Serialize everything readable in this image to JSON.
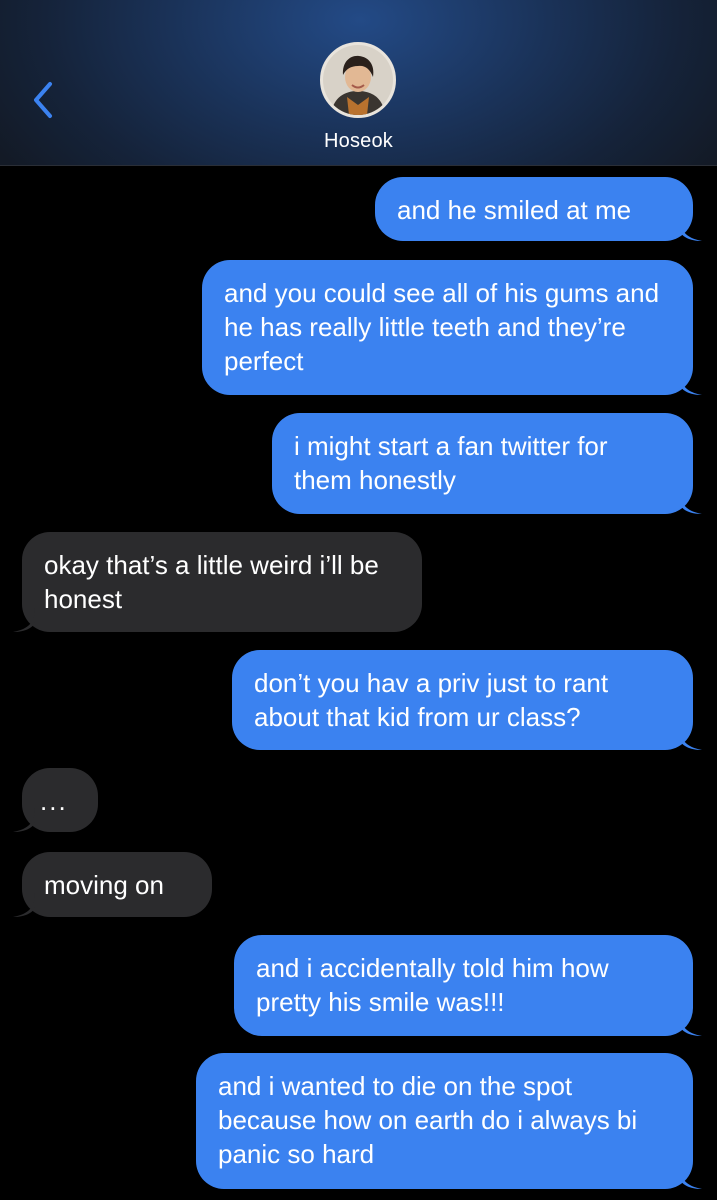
{
  "header": {
    "contact_name": "Hoseok",
    "back_icon": "chevron-left-icon",
    "avatar_icon": "contact-avatar"
  },
  "colors": {
    "sent_bubble": "#3b82f0",
    "received_bubble": "#2b2b2d",
    "accent": "#3b82f0",
    "background": "#000000"
  },
  "messages": [
    {
      "direction": "sent",
      "text": "and he smiled at me"
    },
    {
      "direction": "sent",
      "text": "and you could see all of his gums and he has really little teeth and they’re perfect"
    },
    {
      "direction": "sent",
      "text": "i might start a fan twitter for them honestly"
    },
    {
      "direction": "received",
      "text": "okay that’s a little weird i’ll be honest"
    },
    {
      "direction": "sent",
      "text": "don’t you hav a priv just to rant about that kid from ur class?"
    },
    {
      "direction": "received",
      "text": "..."
    },
    {
      "direction": "received",
      "text": "moving on"
    },
    {
      "direction": "sent",
      "text": "and i accidentally told him how pretty his smile was!!!"
    },
    {
      "direction": "sent",
      "text": "and i wanted to die on the spot because how on earth do i always bi panic so hard"
    }
  ]
}
